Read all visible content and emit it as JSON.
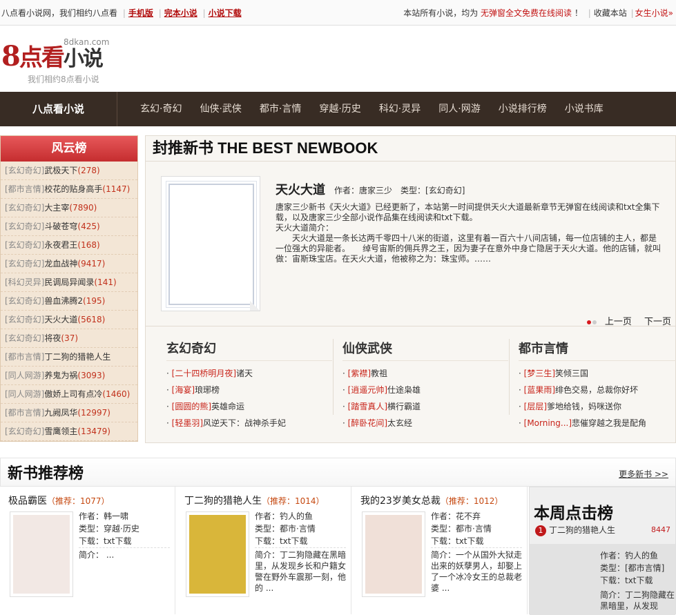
{
  "topbar": {
    "welcome": "八点看小说网，我们相约八点看",
    "links": [
      "手机版",
      "完本小说",
      "小说下载"
    ],
    "notice_pre": "本站所有小说，均为",
    "notice_hl": "无弹窗全文免费在线阅读",
    "notice_post": "！",
    "favorite": "收藏本站",
    "female": "女生小说»"
  },
  "logo": {
    "domain": "8dkan.com",
    "title_num": "8",
    "title_a": "点看",
    "title_b": "小说",
    "slogan": "我们相约8点看小说"
  },
  "nav": {
    "home": "八点看小说",
    "items": [
      "玄幻·奇幻",
      "仙侠·武侠",
      "都市·言情",
      "穿越·历史",
      "科幻·灵异",
      "同人·网游",
      "小说排行榜",
      "小说书库"
    ]
  },
  "fengyun": {
    "title": "风云榜",
    "items": [
      {
        "cat": "[玄幻奇幻]",
        "title": "武极天下",
        "num": "(278)"
      },
      {
        "cat": "[都市言情]",
        "title": "校花的贴身高手",
        "num": "(1147)"
      },
      {
        "cat": "[玄幻奇幻]",
        "title": "大主宰",
        "num": "(7890)"
      },
      {
        "cat": "[玄幻奇幻]",
        "title": "斗破苍穹",
        "num": "(425)"
      },
      {
        "cat": "[玄幻奇幻]",
        "title": "永夜君王",
        "num": "(168)"
      },
      {
        "cat": "[玄幻奇幻]",
        "title": "龙血战神",
        "num": "(9417)"
      },
      {
        "cat": "[科幻灵异]",
        "title": "民调局异闻录",
        "num": "(141)"
      },
      {
        "cat": "[玄幻奇幻]",
        "title": "兽血沸腾2",
        "num": "(195)"
      },
      {
        "cat": "[玄幻奇幻]",
        "title": "天火大道",
        "num": "(5618)"
      },
      {
        "cat": "[玄幻奇幻]",
        "title": "将夜",
        "num": "(37)"
      },
      {
        "cat": "[都市言情]",
        "title": "丁二狗的猎艳人生",
        "num": ""
      },
      {
        "cat": "[同人网游]",
        "title": "养鬼为祸",
        "num": "(3093)"
      },
      {
        "cat": "[同人网游]",
        "title": "傲娇上司有点冷",
        "num": "(1460)"
      },
      {
        "cat": "[都市言情]",
        "title": "九阙凤华",
        "num": "(12997)"
      },
      {
        "cat": "[玄幻奇幻]",
        "title": "雪鹰领主",
        "num": "(13479)"
      }
    ]
  },
  "feature": {
    "heading": "封推新书 THE BEST NEWBOOK",
    "book_title": "天火大道",
    "author": "作者：唐家三少",
    "type": "类型：[玄幻奇幻]",
    "desc1": "唐家三少新书《天火大道》已经更新了，本站第一时间提供天火大道最新章节无弹窗在线阅读和txt全集下载，以及唐家三少全部小说作品集在线阅读和txt下载。",
    "desc2": "天火大道简介：",
    "desc3": "　　天火大道是一条长达两千零四十八米的街道，这里有着一百六十八间店铺，每一位店铺的主人，都是一位强大的异能者。　　绰号宙斯的佣兵界之王，因为妻子在意外中身亡隐居于天火大道。他的店铺，就叫做：宙斯珠宝店。在天火大道，他被称之为：珠宝师。……",
    "prev": "上一页",
    "next": "下一页"
  },
  "cats": [
    {
      "name": "玄幻奇幻",
      "items": [
        {
          "a": "[二十四桥明月夜]",
          "b": "诸天"
        },
        {
          "a": "[海宴]",
          "b": "琅琊榜"
        },
        {
          "a": "[圆圆的熊]",
          "b": "英雄命运"
        },
        {
          "a": "[轻墨羽]",
          "b": "风逆天下：战神杀手妃"
        }
      ]
    },
    {
      "name": "仙侠武侠",
      "items": [
        {
          "a": "[紫襟]",
          "b": "教祖"
        },
        {
          "a": "[逍遥元帅]",
          "b": "仕途枭雄"
        },
        {
          "a": "[踏雪真人]",
          "b": "横行霸道"
        },
        {
          "a": "[醉卧花间]",
          "b": "太玄经"
        }
      ]
    },
    {
      "name": "都市言情",
      "items": [
        {
          "a": "[梦三生]",
          "b": "笑倾三国"
        },
        {
          "a": "[蓝果雨]",
          "b": "绯色交易，总裁你好坏"
        },
        {
          "a": "[层层]",
          "b": "爹地给钱，妈咪送你"
        },
        {
          "a": "[Morning...]",
          "b": "悲催穿越之我是配角"
        }
      ]
    }
  ],
  "newrank": {
    "title": "新书推荐榜",
    "more": "更多新书 >>"
  },
  "newbooks": [
    {
      "title": "极品霸医",
      "rec": "（推荐：1077）",
      "author": "作者：韩一啸",
      "type": "类型：穿越·历史",
      "dl": "下载：txt下载",
      "intro": "简介： ..."
    },
    {
      "title": "丁二狗的猎艳人生",
      "rec": "（推荐：1014）",
      "author": "作者：钓人的鱼",
      "type": "类型：都市·言情",
      "dl": "下载：txt下载",
      "intro": "简介：丁二狗隐藏在黑暗里，从发现乡长和户籍女警在野外车震那一刻，他的 ..."
    },
    {
      "title": "我的23岁美女总裁",
      "rec": "（推荐：1012）",
      "author": "作者：花不弃",
      "type": "类型：都市·言情",
      "dl": "下载：txt下载",
      "intro": "简介：一个从国外大狱走出来的妖孽男人，却娶上了一个冰冷女王的总裁老婆 ..."
    }
  ],
  "weekly": {
    "title": "本周点击榜",
    "rank": "1",
    "book": "丁二狗的猎艳人生",
    "count": "8447",
    "author": "作者：钓人的鱼",
    "type": "类型：[都市言情]",
    "dl": "下载：txt下载",
    "intro": "简介：丁二狗隐藏在黑暗里，从发现"
  }
}
